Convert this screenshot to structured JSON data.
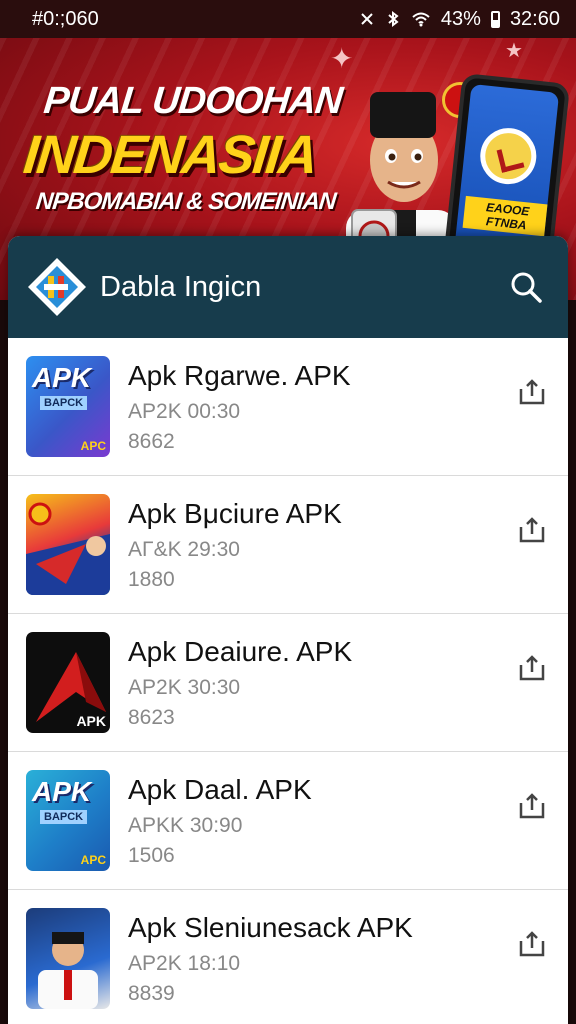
{
  "status_bar": {
    "time_left": "#0:;060",
    "battery_percent": "43%",
    "clock": "32:60"
  },
  "banner": {
    "line1": "PUAL UDOOHAN",
    "line2": "INDENASIIA",
    "line3": "NPBOMABIAI & SOMEINIAN",
    "phone_label": "EAOOE FTNBA"
  },
  "header": {
    "title": "Dabla Ingicn",
    "logo_icon": "app-logo",
    "search_icon": "search-icon"
  },
  "items": [
    {
      "name": "Apk Rgarwe. APK",
      "meta": "AP2K  00:30",
      "size": "8662",
      "thumb_text": "APK",
      "thumb_sub": "BAPCK",
      "thumb_corner": "APC"
    },
    {
      "name": "Apk Bμciure APK",
      "meta": "AΓ&K  29:30",
      "size": "1880",
      "thumb_text": "",
      "thumb_sub": "",
      "thumb_corner": ""
    },
    {
      "name": "Apk Deaiure. APK",
      "meta": "AP2K  30:30",
      "size": "8623",
      "thumb_text": "",
      "thumb_sub": "",
      "thumb_corner": "APK"
    },
    {
      "name": "Apk Daal. APK",
      "meta": "APKK  30:90",
      "size": "1506",
      "thumb_text": "APK",
      "thumb_sub": "BAPCK",
      "thumb_corner": "APC"
    },
    {
      "name": "Apk Sleniunesack APK",
      "meta": "AP2K  18:10",
      "size": "8839",
      "thumb_text": "",
      "thumb_sub": "",
      "thumb_corner": ""
    }
  ],
  "colors": {
    "app_bar": "#173c4c",
    "banner_red": "#a8131b",
    "banner_yellow": "#ffd21a"
  }
}
